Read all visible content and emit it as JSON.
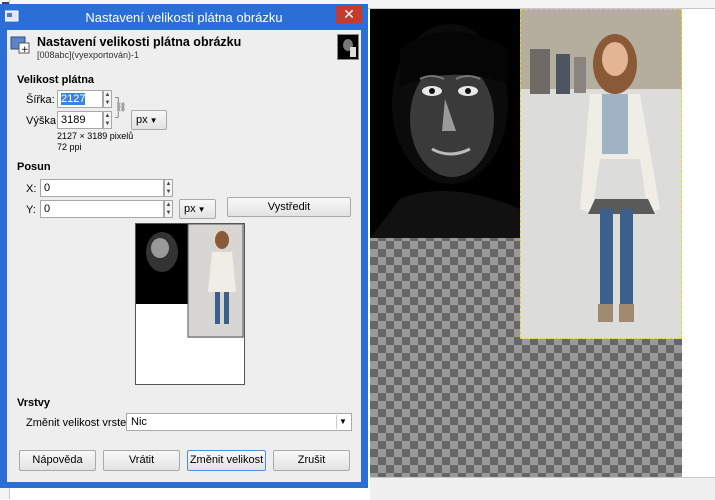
{
  "dialog": {
    "window_title": "Nastavení velikosti plátna obrázku",
    "header_title": "Nastavení velikosti plátna obrázku",
    "header_subtitle": "[008abc](vyexportován)-1",
    "close_label": "✕"
  },
  "canvas_size": {
    "section_label": "Velikost plátna",
    "width_label": "Šířka:",
    "width_value": "2127",
    "height_label": "Výška:",
    "height_value": "3189",
    "unit": "px",
    "pixels_info": "2127 × 3189 pixelů",
    "ppi_info": "72 ppi"
  },
  "offset": {
    "section_label": "Posun",
    "x_label": "X:",
    "x_value": "0",
    "y_label": "Y:",
    "y_value": "0",
    "unit": "px",
    "center_label": "Vystředit"
  },
  "layers": {
    "section_label": "Vrstvy",
    "resize_label": "Změnit velikost vrstev:",
    "resize_value": "Nic"
  },
  "buttons": {
    "help": "Nápověda",
    "reset": "Vrátit",
    "resize": "Změnit velikost",
    "cancel": "Zrušit"
  },
  "icons": {
    "app": "canvas-resize-icon",
    "close": "close-icon",
    "chain": "chain-link-icon",
    "dropdown": "chevron-down-icon"
  },
  "colors": {
    "titlebar": "#2b6fd6",
    "close": "#c73b2d",
    "selection_dash": "#e6d820"
  }
}
